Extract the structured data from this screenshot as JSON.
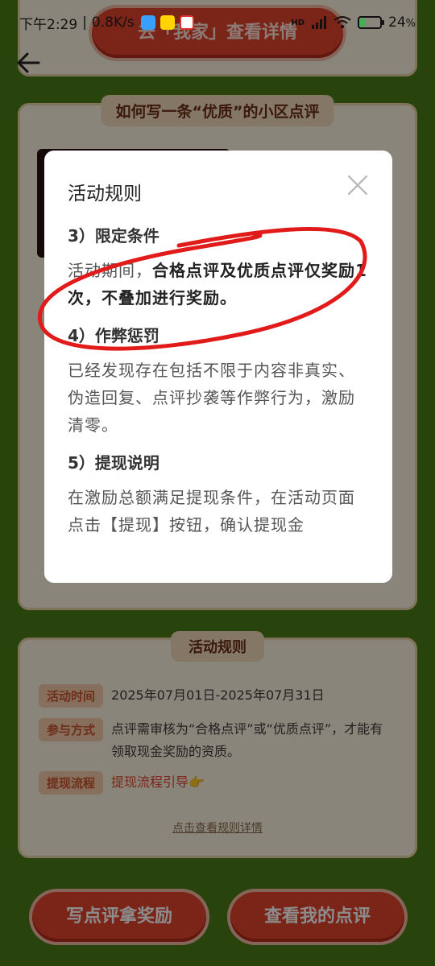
{
  "status_bar": {
    "time": "下午2:29",
    "speed": "0.8K/s",
    "signal": "HD",
    "battery": "24",
    "battery_unit": "%",
    "battery_level": 0.24
  },
  "background": {
    "top_button": "去「我家」查看详情",
    "section_title": "如何写一条“优质”的小区点评",
    "rules_title": "活动规则",
    "rows": [
      {
        "badge": "活动时间",
        "text": "2025年07月01日-2025年07月31日"
      },
      {
        "badge": "参与方式",
        "text": "点评需审核为“合格点评”或“优质点评”，才能有领取现金奖励的资质。"
      },
      {
        "badge": "提现流程",
        "text": "提现流程引导👉"
      }
    ],
    "detail_link": "点击查看规则详情",
    "btn_write": "写点评拿奖励",
    "btn_mine": "查看我的点评"
  },
  "modal": {
    "title": "活动规则",
    "sections": [
      {
        "heading": "3）限定条件",
        "text_plain": "活动期间，",
        "text_bold": "合格点评及优质点评仅奖励1次，不叠加进行奖励。"
      },
      {
        "heading": "4）作弊惩罚",
        "text_plain": "已经发现存在包括不限于内容非真实、伪造回复、点评抄袭等作弊行为，激励清零。",
        "text_bold": ""
      },
      {
        "heading": "5）提现说明",
        "text_plain": "在激励总额满足提现条件，在活动页面点击【提现】按钮，确认提现金",
        "text_bold": ""
      }
    ]
  },
  "colors": {
    "accent_red": "#e0442f",
    "annotation_red": "#e11a1a",
    "bg_green": "#4a7a15"
  },
  "icons": {
    "back": "back-arrow-icon",
    "close": "close-icon"
  }
}
